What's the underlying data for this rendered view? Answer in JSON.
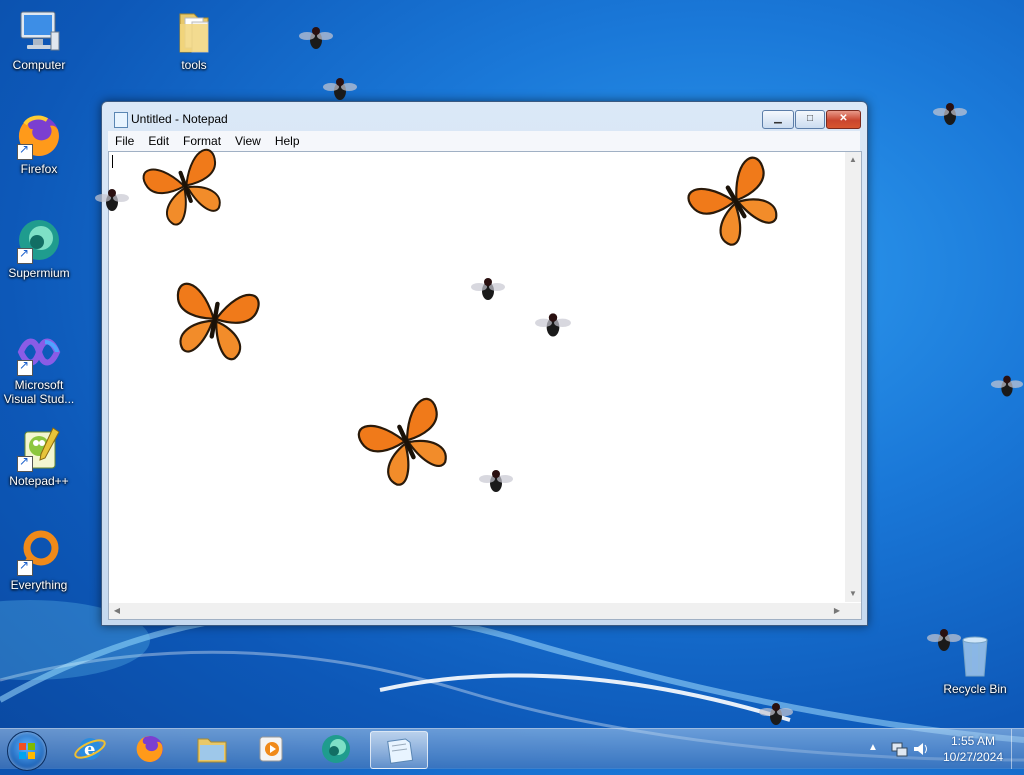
{
  "desktop": {
    "icons": [
      {
        "label": "Computer",
        "icon": "computer-icon"
      },
      {
        "label": "tools",
        "icon": "folder-icon"
      },
      {
        "label": "Firefox",
        "icon": "firefox-icon"
      },
      {
        "label": "Supermium",
        "icon": "supermium-icon"
      },
      {
        "label": "Microsoft Visual Stud...",
        "icon": "visual-studio-icon"
      },
      {
        "label": "Notepad++",
        "icon": "notepad-plus-plus-icon"
      },
      {
        "label": "Everything",
        "icon": "everything-search-icon"
      },
      {
        "label": "Recycle Bin",
        "icon": "recycle-bin-icon"
      }
    ]
  },
  "notepad": {
    "title": "Untitled - Notepad",
    "menu": [
      "File",
      "Edit",
      "Format",
      "View",
      "Help"
    ],
    "content": ""
  },
  "taskbar": {
    "pinned": [
      {
        "name": "start-button",
        "icon": "windows-logo-icon"
      },
      {
        "name": "internet-explorer",
        "icon": "internet-explorer-icon"
      },
      {
        "name": "firefox",
        "icon": "firefox-icon"
      },
      {
        "name": "file-explorer",
        "icon": "folder-icon"
      },
      {
        "name": "media-player",
        "icon": "media-player-icon"
      },
      {
        "name": "supermium",
        "icon": "supermium-icon"
      },
      {
        "name": "notepad",
        "icon": "notepad-icon",
        "active": true
      }
    ],
    "clock": {
      "time": "1:55 AM",
      "date": "10/27/2024"
    }
  },
  "colors": {
    "accent": "#1a78d8",
    "close_button": "#c9452e",
    "butterfly": "#f07a1a"
  }
}
